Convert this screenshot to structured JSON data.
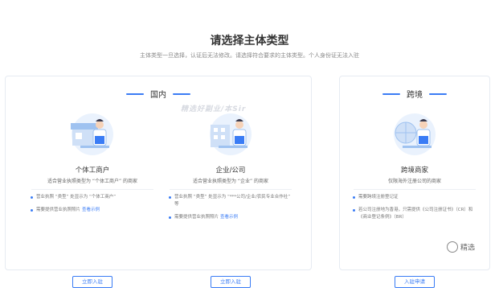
{
  "page": {
    "title": "请选择主体类型",
    "subtitle": "主体类型一旦选择，认证后无法修改。请选择符合要求的主体类型。个人身份证无法入驻"
  },
  "domestic": {
    "header": "国内",
    "cards": [
      {
        "title": "个体工商户",
        "subtitle": "适合营业执照类型为 “个体工商户” 的商家",
        "bullets": [
          {
            "text": "营业执照 “类型” 处显示为 “个体工商户”",
            "link": ""
          },
          {
            "text": "需要提供营业执照照片",
            "link": "查看示例"
          }
        ],
        "button": "立即入驻"
      },
      {
        "title": "企业/公司",
        "subtitle": "适合营业执照类型为 “企业” 的商家",
        "bullets": [
          {
            "text": "营业执照 “类型” 处显示为 “***公司/企业/农民专业合作社” 等",
            "link": ""
          },
          {
            "text": "需要提供营业执照照片",
            "link": "查看示例"
          }
        ],
        "button": "立即入驻"
      }
    ]
  },
  "crossborder": {
    "header": "跨境",
    "card": {
      "title": "跨境商家",
      "subtitle": "仅限海外注册公司的商家",
      "bullets": [
        {
          "text": "需要跨境注册登记证",
          "link": ""
        },
        {
          "text": "若公司注册地为香港，只需提供《公司注册证书》（CR）和《商业登记条例》（BR）",
          "link": ""
        }
      ],
      "button": "入驻申请"
    }
  },
  "watermark": "精选好副业/本Sir",
  "corner_logo": "精选",
  "colors": {
    "accent": "#3a7cf5",
    "border": "#e6ebf2"
  }
}
